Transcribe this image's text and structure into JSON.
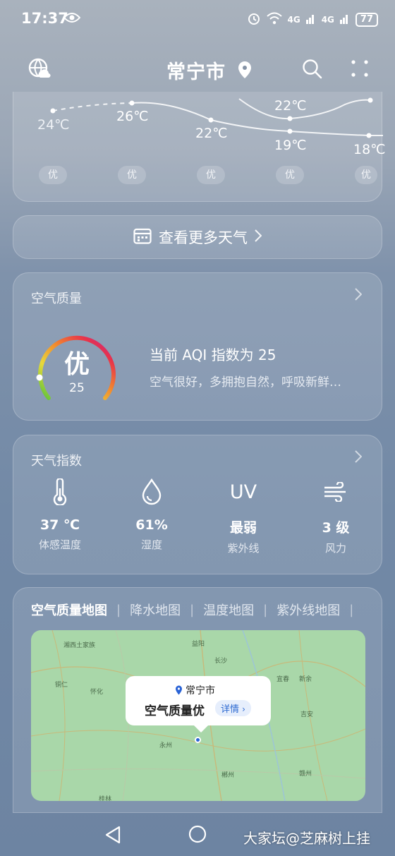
{
  "status_bar": {
    "time": "17:37",
    "signal1": "4G",
    "signal2": "4G",
    "battery": "77"
  },
  "header": {
    "city": "常宁市"
  },
  "forecast": {
    "temps": [
      "24℃",
      "26℃",
      "22℃",
      "19℃",
      "18℃"
    ],
    "high_visible": "22℃",
    "aqi_pills": [
      "优",
      "优",
      "优",
      "优",
      "优"
    ]
  },
  "more_weather": {
    "label": "查看更多天气"
  },
  "air_quality": {
    "title": "空气质量",
    "level": "优",
    "value": "25",
    "headline": "当前 AQI 指数为 25",
    "description": "空气很好，多拥抱自然，呼吸新鲜…"
  },
  "weather_index": {
    "title": "天气指数",
    "items": [
      {
        "icon": "thermometer-icon",
        "value": "37 ℃",
        "label": "体感温度"
      },
      {
        "icon": "humidity-drop-icon",
        "value": "61%",
        "label": "湿度"
      },
      {
        "icon": "uv-icon",
        "icon_text": "UV",
        "value": "最弱",
        "label": "紫外线"
      },
      {
        "icon": "wind-icon",
        "value": "3 级",
        "label": "风力"
      }
    ]
  },
  "maps": {
    "tabs": [
      "空气质量地图",
      "降水地图",
      "温度地图",
      "紫外线地图"
    ],
    "popup": {
      "city": "常宁市",
      "quality": "空气质量优",
      "detail": "详情"
    },
    "places": [
      "益阳",
      "长沙",
      "怀化",
      "铜仁",
      "宜春",
      "新余",
      "吉安",
      "永州",
      "郴州",
      "赣州",
      "湘西土家族",
      "桂林"
    ]
  },
  "watermark": "大家坛@芝麻树上挂"
}
